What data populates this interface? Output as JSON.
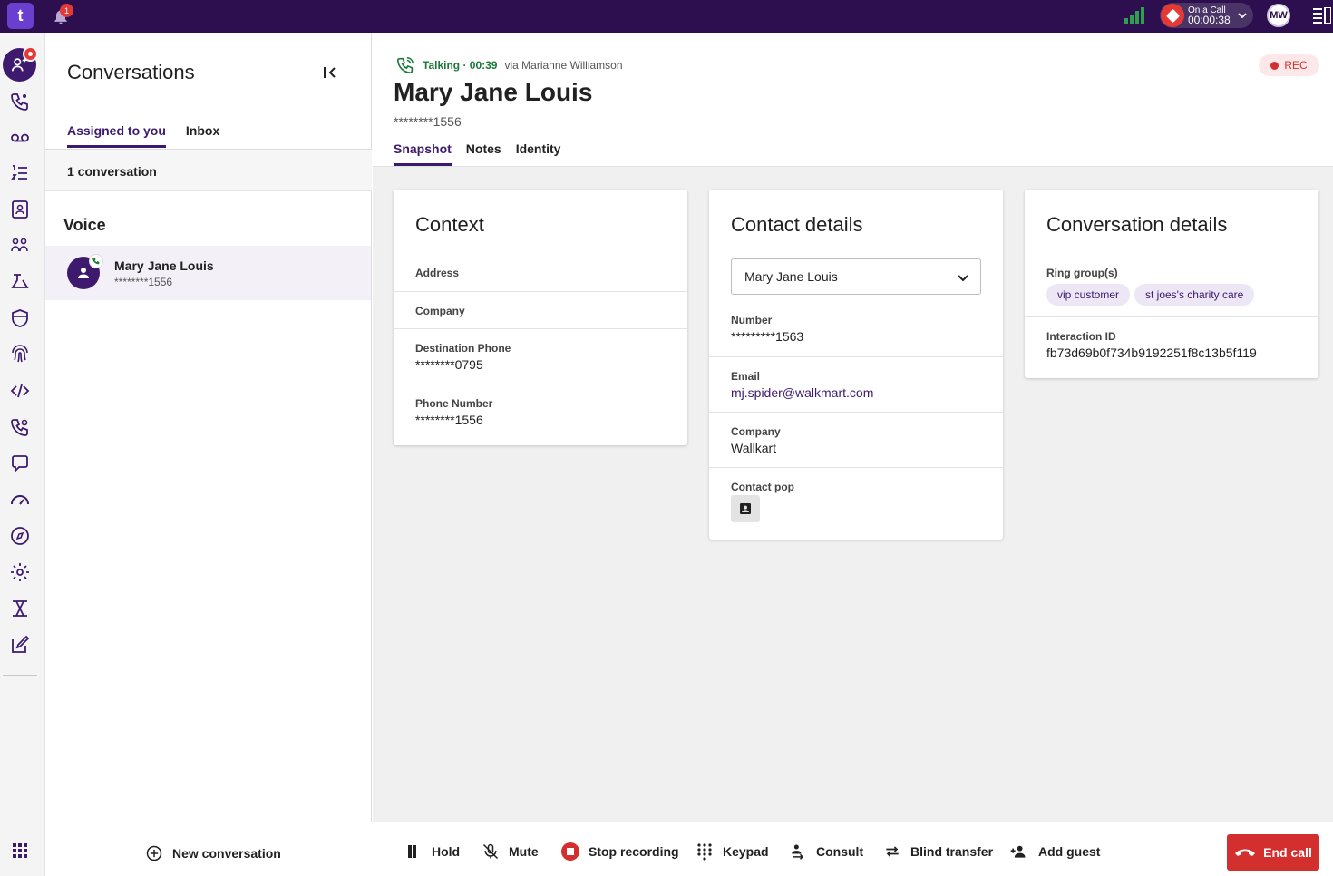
{
  "topbar": {
    "logo": "t",
    "notification_count": "1",
    "call_status_line1": "On a Call",
    "call_status_line2": "00:00:38",
    "user_initials": "MW"
  },
  "rail": {
    "items": [
      "agent-icon",
      "phone-network-icon",
      "voicemail-icon",
      "task-list-icon",
      "contacts-icon",
      "teams-icon",
      "flow-icon",
      "shield-icon",
      "fingerprint-icon",
      "code-icon",
      "phone-settings-icon",
      "chat-icon",
      "dashboard-icon",
      "compass-icon",
      "settings-icon",
      "routing-icon",
      "edit-icon"
    ]
  },
  "conversations": {
    "title": "Conversations",
    "tabs": [
      {
        "label": "Assigned to you",
        "active": true
      },
      {
        "label": "Inbox",
        "active": false
      }
    ],
    "count_text": "1 conversation",
    "section": "Voice",
    "items": [
      {
        "name": "Mary Jane Louis",
        "number": "********1556"
      }
    ],
    "new_conversation": "New conversation"
  },
  "header": {
    "status_talking": "Talking · 00:39",
    "status_via": "via Marianne Williamson",
    "rec_label": "REC",
    "contact_name": "Mary Jane Louis",
    "contact_number": "********1556",
    "tabs": [
      {
        "label": "Snapshot",
        "active": true
      },
      {
        "label": "Notes",
        "active": false
      },
      {
        "label": "Identity",
        "active": false
      }
    ]
  },
  "context_card": {
    "title": "Context",
    "address_label": "Address",
    "company_label": "Company",
    "destination_phone_label": "Destination Phone",
    "destination_phone_value": "********0795",
    "phone_number_label": "Phone Number",
    "phone_number_value": "********1556"
  },
  "contact_card": {
    "title": "Contact details",
    "selected_contact": "Mary Jane Louis",
    "number_label": "Number",
    "number_value": "*********1563",
    "email_label": "Email",
    "email_value": "mj.spider@walkmart.com",
    "company_label": "Company",
    "company_value": "Wallkart",
    "contact_pop_label": "Contact pop"
  },
  "conversation_card": {
    "title": "Conversation details",
    "ring_groups_label": "Ring group(s)",
    "ring_groups": [
      "vip customer",
      "st joes's charity care"
    ],
    "interaction_id_label": "Interaction ID",
    "interaction_id_value": "fb73d69b0f734b9192251f8c13b5f119"
  },
  "callbar": {
    "hold": "Hold",
    "mute": "Mute",
    "stop_recording": "Stop recording",
    "keypad": "Keypad",
    "consult": "Consult",
    "blind_transfer": "Blind transfer",
    "add_guest": "Add guest",
    "end_call": "End call"
  },
  "colors": {
    "topbar": "#2d0f4f",
    "accent": "#3d1a6e",
    "danger": "#d32f2f",
    "talking": "#1a7a3a"
  }
}
